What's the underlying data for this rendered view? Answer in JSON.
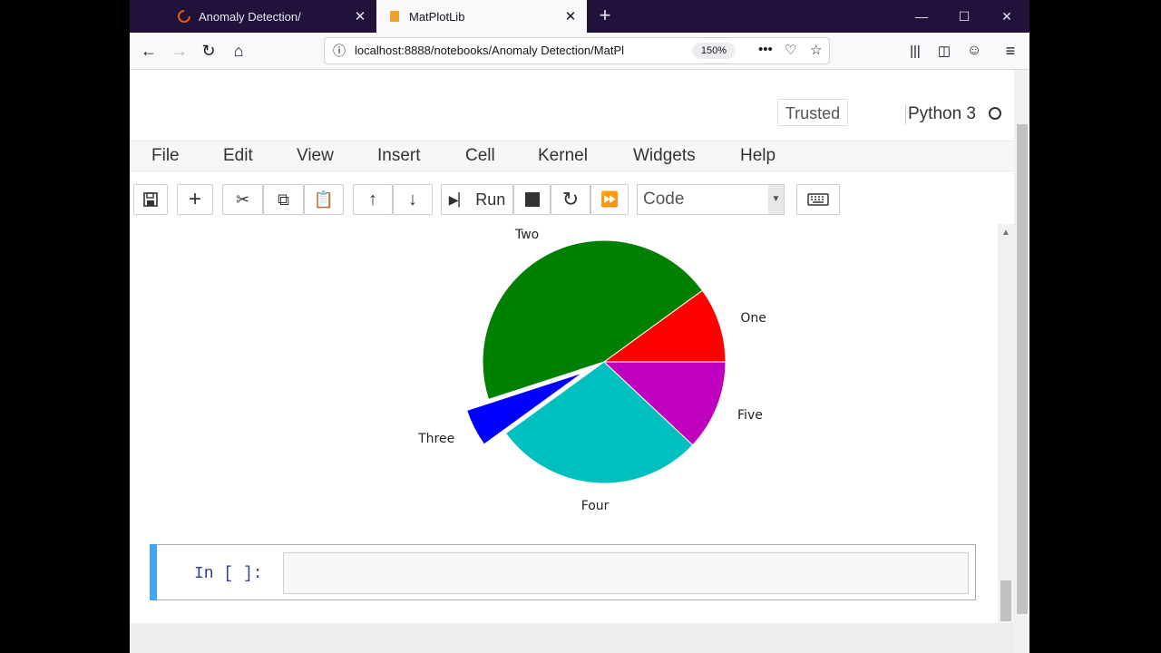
{
  "browser": {
    "tabs": [
      {
        "title": "Anomaly Detection/",
        "active": false,
        "icon": "loading-spinner-icon"
      },
      {
        "title": "MatPlotLib",
        "active": true,
        "icon": "notebook-icon"
      }
    ],
    "url": "localhost:8888/notebooks/Anomaly Detection/MatPl",
    "zoom": "150%"
  },
  "jupyter": {
    "trusted_label": "Trusted",
    "kernel_name": "Python 3",
    "menu": [
      "File",
      "Edit",
      "View",
      "Insert",
      "Cell",
      "Kernel",
      "Widgets",
      "Help"
    ],
    "toolbar": {
      "run_label": "Run",
      "cell_type": "Code"
    }
  },
  "chart_data": {
    "type": "pie",
    "labels": [
      "One",
      "Two",
      "Three",
      "Four",
      "Five"
    ],
    "values": [
      10,
      45,
      5,
      28,
      12
    ],
    "colors": [
      "#ff0000",
      "#008000",
      "#0000ff",
      "#00bfbf",
      "#bf00bf"
    ],
    "explode": [
      0,
      0,
      0.2,
      0,
      0
    ]
  },
  "cell": {
    "prompt": "In [ ]:"
  }
}
